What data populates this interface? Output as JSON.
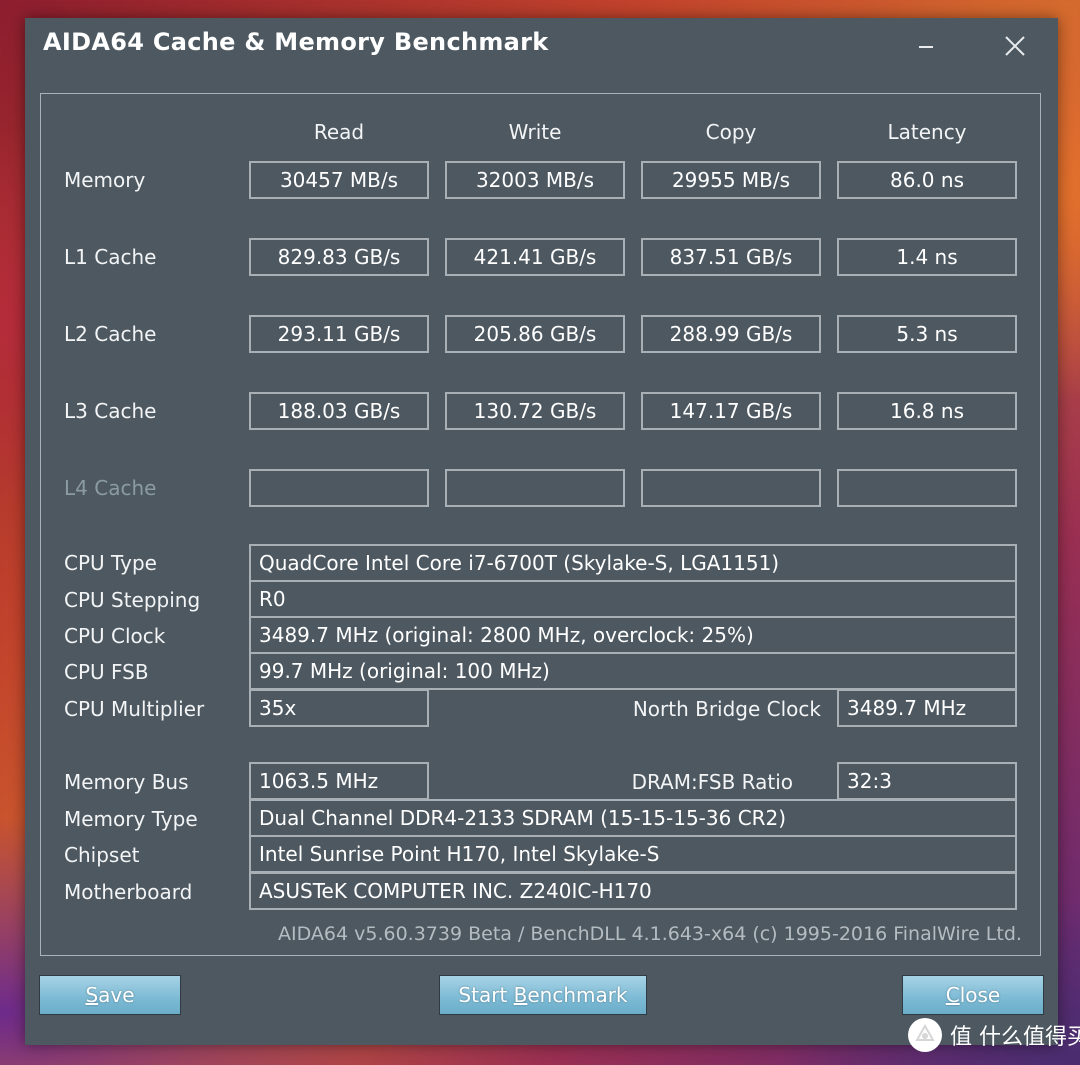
{
  "window": {
    "title": "AIDA64 Cache & Memory Benchmark",
    "minimize_label": "Minimize",
    "close_label": "Close window"
  },
  "headers": [
    "Read",
    "Write",
    "Copy",
    "Latency"
  ],
  "rows": [
    {
      "label": "Memory",
      "read": "30457 MB/s",
      "write": "32003 MB/s",
      "copy": "29955 MB/s",
      "latency": "86.0 ns"
    },
    {
      "label": "L1 Cache",
      "read": "829.83 GB/s",
      "write": "421.41 GB/s",
      "copy": "837.51 GB/s",
      "latency": "1.4 ns"
    },
    {
      "label": "L2 Cache",
      "read": "293.11 GB/s",
      "write": "205.86 GB/s",
      "copy": "288.99 GB/s",
      "latency": "5.3 ns"
    },
    {
      "label": "L3 Cache",
      "read": "188.03 GB/s",
      "write": "130.72 GB/s",
      "copy": "147.17 GB/s",
      "latency": "16.8 ns"
    },
    {
      "label": "L4 Cache",
      "read": "",
      "write": "",
      "copy": "",
      "latency": ""
    }
  ],
  "info": {
    "cpu_type": {
      "label": "CPU Type",
      "value": "QuadCore Intel Core i7-6700T  (Skylake-S, LGA1151)"
    },
    "cpu_stepping": {
      "label": "CPU Stepping",
      "value": "R0"
    },
    "cpu_clock": {
      "label": "CPU Clock",
      "value": "3489.7 MHz  (original: 2800 MHz, overclock: 25%)"
    },
    "cpu_fsb": {
      "label": "CPU FSB",
      "value": "99.7 MHz  (original: 100 MHz)"
    },
    "cpu_multiplier": {
      "label": "CPU Multiplier",
      "value": "35x"
    },
    "north_bridge_clock": {
      "label": "North Bridge Clock",
      "value": "3489.7 MHz"
    },
    "memory_bus": {
      "label": "Memory Bus",
      "value": "1063.5 MHz"
    },
    "dram_fsb_ratio": {
      "label": "DRAM:FSB Ratio",
      "value": "32:3"
    },
    "memory_type": {
      "label": "Memory Type",
      "value": "Dual Channel DDR4-2133 SDRAM  (15-15-15-36 CR2)"
    },
    "chipset": {
      "label": "Chipset",
      "value": "Intel Sunrise Point H170, Intel Skylake-S"
    },
    "motherboard": {
      "label": "Motherboard",
      "value": "ASUSTeK COMPUTER INC. Z240IC-H170"
    }
  },
  "footer": "AIDA64 v5.60.3739 Beta / BenchDLL 4.1.643-x64  (c) 1995-2016 FinalWire Ltd.",
  "buttons": {
    "save": {
      "accel": "S",
      "rest": "ave"
    },
    "start": {
      "pre": "Start ",
      "accel": "B",
      "rest": "enchmark"
    },
    "close": {
      "accel": "C",
      "rest": "lose"
    }
  },
  "watermark": "值 什么值得买",
  "colors": {
    "window_bg": "#4d5861",
    "button": "#7fbcd6",
    "border": "#a8b0b5",
    "disabled_label": "#8b9ca1"
  }
}
